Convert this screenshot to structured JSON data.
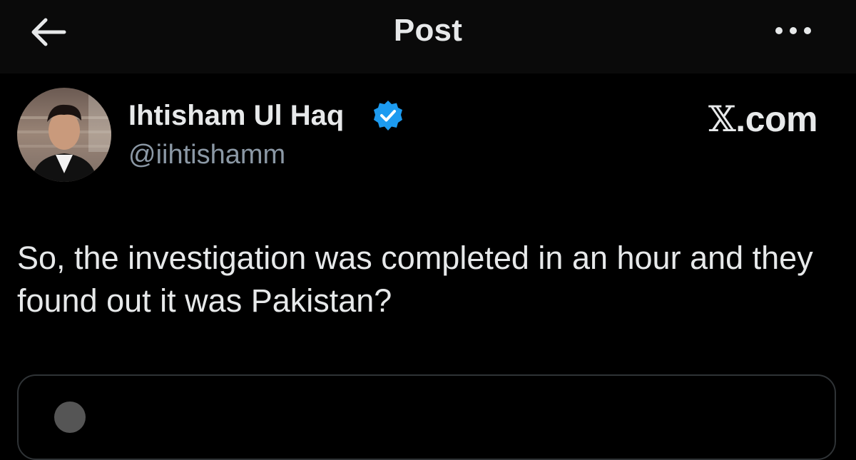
{
  "header": {
    "title": "Post",
    "back_icon": "arrow-left-icon",
    "more_icon": "more-horizontal-icon"
  },
  "author": {
    "name": "Ihtisham Ul Haq",
    "handle": "@iihtishamm",
    "verified": true,
    "verified_color": "#1d9bf0"
  },
  "brand": {
    "x_glyph": "𝕏",
    "suffix": ".com"
  },
  "post": {
    "text": "So, the investigation was completed in an hour and they found out it was Pakistan?"
  },
  "colors": {
    "background": "#000000",
    "header_background": "#0a0a0a",
    "text_primary": "#e7e9ea",
    "text_secondary": "#8b98a5",
    "border": "#2f3336"
  }
}
